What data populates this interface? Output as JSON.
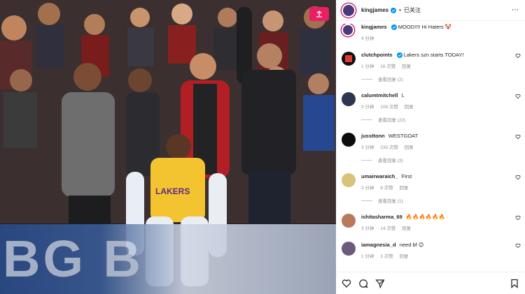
{
  "post": {
    "username": "kingjames",
    "follow_state": "已关注",
    "caption_user": "kingjames",
    "caption_text": "MOOD!!!! Hi Haters 🤡",
    "caption_time": "4 分钟"
  },
  "photo": {
    "ad_text": "BG  B",
    "jersey_text": "LAKERS"
  },
  "comments": [
    {
      "user": "clutchpoints",
      "verified": true,
      "text": "Lakers szn starts TODAY!",
      "time": "1 分钟",
      "likes": "16 次赞",
      "reply": "回复",
      "view_replies": "查看回复 (2)"
    },
    {
      "user": "calumtmitchell",
      "verified": false,
      "text": "L",
      "time": "3 分钟",
      "likes": "108 次赞",
      "reply": "回复",
      "view_replies": "查看回复 (22)"
    },
    {
      "user": "jussttonn",
      "verified": false,
      "text": "WESTGOAT",
      "time": "3 分钟",
      "likes": "233 次赞",
      "reply": "回复",
      "view_replies": "查看回复 (3)"
    },
    {
      "user": "umairwaraich_",
      "verified": false,
      "text": "First",
      "time": "3 分钟",
      "likes": "9 次赞",
      "reply": "回复",
      "view_replies": "查看回复 (1)"
    },
    {
      "user": "ishitasharma_69",
      "verified": false,
      "text": "🔥🔥🔥🔥🔥🔥",
      "time": "3 分钟",
      "likes": "14 次赞",
      "reply": "回复",
      "view_replies": ""
    },
    {
      "user": "iamagnesia_d",
      "verified": false,
      "text": "need bf 😊",
      "time": "1 分钟",
      "likes": "3 次赞",
      "reply": "回复",
      "view_replies": ""
    }
  ],
  "colors": {
    "accent": "#0095f6",
    "upload": "#e91e63",
    "lakers_gold": "#f4c430"
  },
  "icons": [
    "heart-icon",
    "comment-icon",
    "share-icon",
    "save-icon",
    "verified-icon",
    "upload-icon"
  ]
}
